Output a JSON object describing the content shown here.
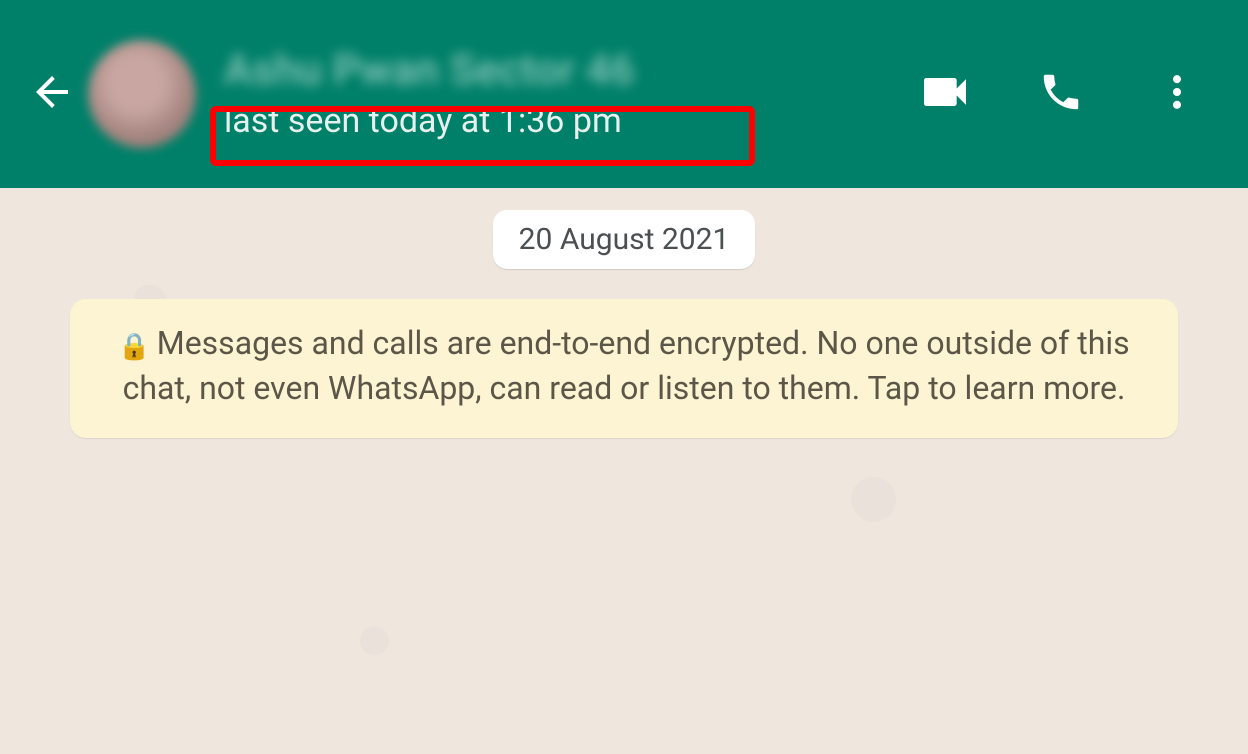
{
  "header": {
    "contact_name": "Ashu Pwan Sector 46",
    "last_seen": "last seen today at 1:36 pm"
  },
  "chat": {
    "date_chip": "20 August 2021",
    "encryption_notice": "Messages and calls are end-to-end encrypted. No one outside of this chat, not even WhatsApp, can read or listen to them. Tap to learn more."
  },
  "icons": {
    "back": "back-arrow",
    "video": "video-camera",
    "voice": "phone",
    "menu": "more-vertical",
    "lock": "lock"
  }
}
